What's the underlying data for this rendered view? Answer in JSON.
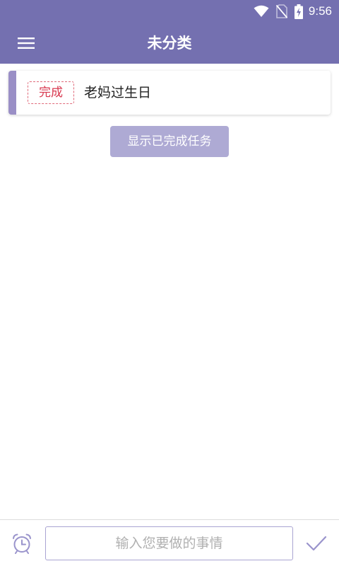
{
  "status_bar": {
    "time": "9:56",
    "icons": [
      "wifi-icon",
      "no-sim-icon",
      "battery-charging-icon"
    ]
  },
  "app_bar": {
    "title": "未分类",
    "menu_icon": "hamburger-menu-icon"
  },
  "tasks": [
    {
      "badge": "完成",
      "title": "老妈过生日",
      "accent_color": "#9a8fc6"
    }
  ],
  "show_completed_label": "显示已完成任务",
  "bottom_bar": {
    "input_value": "",
    "input_placeholder": "输入您要做的事情",
    "alarm_icon": "alarm-clock-icon",
    "confirm_icon": "checkmark-icon"
  },
  "colors": {
    "primary": "#7470b0",
    "button": "#aeaad4",
    "badge_red": "#d8384f"
  }
}
